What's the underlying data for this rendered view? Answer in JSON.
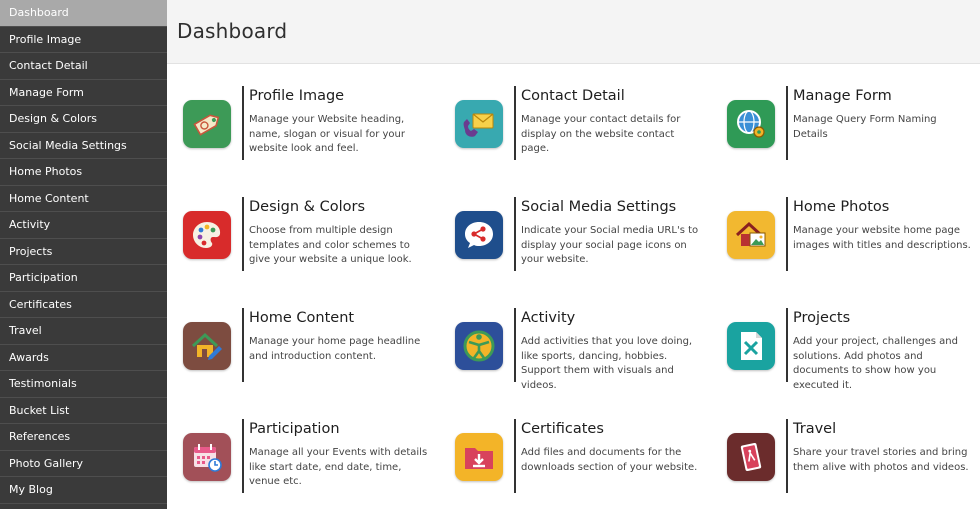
{
  "sidebar": {
    "items": [
      {
        "label": "Dashboard"
      },
      {
        "label": "Profile Image"
      },
      {
        "label": "Contact Detail"
      },
      {
        "label": "Manage Form"
      },
      {
        "label": "Design & Colors"
      },
      {
        "label": "Social Media Settings"
      },
      {
        "label": "Home Photos"
      },
      {
        "label": "Home Content"
      },
      {
        "label": "Activity"
      },
      {
        "label": "Projects"
      },
      {
        "label": "Participation"
      },
      {
        "label": "Certificates"
      },
      {
        "label": "Travel"
      },
      {
        "label": "Awards"
      },
      {
        "label": "Testimonials"
      },
      {
        "label": "Bucket List"
      },
      {
        "label": "References"
      },
      {
        "label": "Photo Gallery"
      },
      {
        "label": "My Blog"
      }
    ]
  },
  "header": {
    "title": "Dashboard"
  },
  "cards": [
    {
      "title": "Profile Image",
      "desc": "Manage your Website heading, name, slogan or visual for your website look and feel.",
      "icon": "tag-icon",
      "color": "#3d9a57"
    },
    {
      "title": "Contact Detail",
      "desc": "Manage your contact details for display on the website contact page.",
      "icon": "envelope-phone-icon",
      "color": "#38a9b0"
    },
    {
      "title": "Manage Form",
      "desc": "Manage Query Form Naming Details",
      "icon": "globe-gear-icon",
      "color": "#2f9a56"
    },
    {
      "title": "Design & Colors",
      "desc": "Choose from multiple design templates and color schemes to give your website a unique look.",
      "icon": "palette-icon",
      "color": "#d82b2b"
    },
    {
      "title": "Social Media Settings",
      "desc": "Indicate your Social media URL's to display your social page icons on your website.",
      "icon": "share-icon",
      "color": "#1f4e8c"
    },
    {
      "title": "Home Photos",
      "desc": "Manage your website home page images with titles and descriptions.",
      "icon": "house-photo-icon",
      "color": "#f2b830"
    },
    {
      "title": "Home Content",
      "desc": "Manage your home page headline and introduction content.",
      "icon": "house-pencil-icon",
      "color": "#7d4c40"
    },
    {
      "title": "Activity",
      "desc": "Add activities that you love doing, like sports, dancing, hobbies. Support them with visuals and videos.",
      "icon": "person-activity-icon",
      "color": "#2d4f9a"
    },
    {
      "title": "Projects",
      "desc": "Add your project, challenges and solutions. Add photos and documents to show how you executed it.",
      "icon": "document-x-icon",
      "color": "#1aa3a0"
    },
    {
      "title": "Participation",
      "desc": "Manage all your Events with details like start date, end date, time, venue etc.",
      "icon": "calendar-clock-icon",
      "color": "#a25058"
    },
    {
      "title": "Certificates",
      "desc": "Add files and documents for the downloads section of your website.",
      "icon": "folder-download-icon",
      "color": "#f3b428"
    },
    {
      "title": "Travel",
      "desc": "Share your travel stories and bring them alive with photos and videos.",
      "icon": "travel-card-icon",
      "color": "#6b2c2c"
    }
  ]
}
